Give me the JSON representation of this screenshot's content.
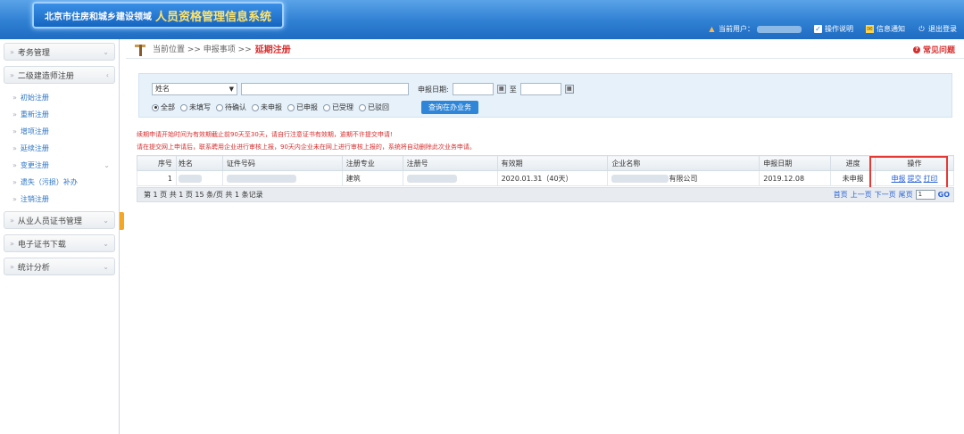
{
  "header": {
    "title_sub": "北京市住房和城乡建设领域",
    "title_main": "人员资格管理信息系统",
    "current_user_label": "当前用户：",
    "help_label": "操作说明",
    "notify_label": "信息通知",
    "logout_label": "退出登录"
  },
  "sidebar": {
    "sections": [
      {
        "label": "考务管理"
      },
      {
        "label": "二级建造师注册"
      }
    ],
    "sub_items": [
      {
        "label": "初始注册"
      },
      {
        "label": "重新注册"
      },
      {
        "label": "增项注册"
      },
      {
        "label": "延续注册"
      },
      {
        "label": "变更注册"
      },
      {
        "label": "遗失（污损）补办"
      },
      {
        "label": "注销注册"
      }
    ],
    "bottom_sections": [
      {
        "label": "从业人员证书管理"
      },
      {
        "label": "电子证书下载"
      },
      {
        "label": "统计分析"
      }
    ]
  },
  "breadcrumb": {
    "prefix": "当前位置 >> 申报事项 >>",
    "current": "延期注册",
    "faq": "常见问题"
  },
  "search": {
    "field_select": "姓名",
    "date_label": "申报日期:",
    "date_to": "至",
    "radios": [
      "全部",
      "未填写",
      "待确认",
      "未申报",
      "已申报",
      "已受理",
      "已驳回"
    ],
    "selected_radio": "全部",
    "query_button": "查询在办业务"
  },
  "notices": [
    "续期申请开始时间为有效期截止前90天至30天，请自行注意证书有效期，逾期不许提交申请!",
    "请在提交网上申请后，联系聘用企业进行审核上报，90天内企业未在网上进行审核上报的，系统将自动删除此次业务申请。"
  ],
  "table": {
    "columns": [
      "序号",
      "姓名",
      "证件号码",
      "注册专业",
      "注册号",
      "有效期",
      "企业名称",
      "申报日期",
      "进度",
      "操作"
    ],
    "rows": [
      {
        "index": "1",
        "major": "建筑",
        "validity": "2020.01.31（40天）",
        "company_suffix": "有限公司",
        "date": "2019.12.08",
        "progress": "未申报",
        "ops": [
          "申报",
          "提交",
          "打印"
        ]
      }
    ]
  },
  "pager": {
    "summary": "第 1 页  共 1 页  15 条/页  共 1 条记录",
    "links": [
      "首页",
      "上一页",
      "下一页",
      "尾页"
    ],
    "page_value": "1",
    "go": "GO"
  }
}
